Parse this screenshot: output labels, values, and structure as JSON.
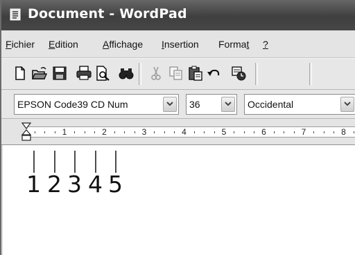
{
  "window": {
    "title": "Document - WordPad",
    "icon": "document-icon"
  },
  "menubar": {
    "items": [
      {
        "key": "F",
        "rest": "ichier"
      },
      {
        "key": "E",
        "rest": "dition"
      },
      {
        "key": "A",
        "rest": "ffichage"
      },
      {
        "key": "I",
        "rest": "nsertion"
      },
      {
        "pre": "Forma",
        "key": "t",
        "rest": ""
      },
      {
        "key": "?",
        "rest": ""
      }
    ]
  },
  "toolbar": {
    "buttons": [
      "new-document-icon",
      "open-folder-icon",
      "save-icon",
      "print-icon",
      "print-preview-icon",
      "find-icon",
      "cut-icon",
      "copy-icon",
      "paste-icon",
      "undo-icon",
      "insert-date-time-icon"
    ]
  },
  "format": {
    "font": "EPSON Code39 CD Num",
    "size": "36",
    "script": "Occidental"
  },
  "ruler": {
    "numbers": [
      "1",
      "2",
      "3",
      "4",
      "5",
      "6",
      "7",
      "8"
    ]
  },
  "document": {
    "digits": [
      "1",
      "2",
      "3",
      "4",
      "5"
    ]
  },
  "colors": {
    "titlebar": "#4a4a4a",
    "menubar": "#e4e4e4",
    "toolbar": "#e7e7e7",
    "document": "#ffffff"
  }
}
